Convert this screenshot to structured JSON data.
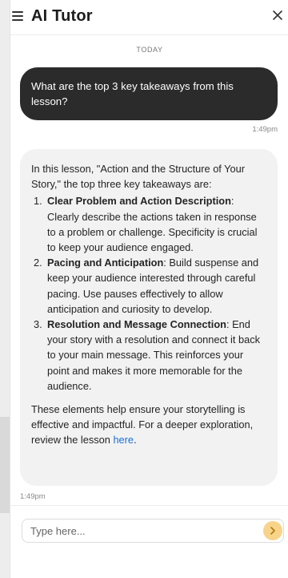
{
  "header": {
    "title": "AI Tutor"
  },
  "chat": {
    "date_separator": "TODAY",
    "user_message": "What are the top 3 key takeaways from this lesson?",
    "user_time": "1:49pm",
    "bot": {
      "intro": "In this lesson, \"Action and the Structure of Your Story,\" the top three key takeaways are:",
      "items": [
        {
          "num": "1.",
          "title": "Clear Problem and Action Description",
          "text": ": Clearly describe the actions taken in response to a problem or challenge. Specificity is crucial to keep your audience engaged."
        },
        {
          "num": "2.",
          "title": "Pacing and Anticipation",
          "text": ": Build suspense and keep your audience interested through careful pacing. Use pauses effectively to allow anticipation and curiosity to develop."
        },
        {
          "num": "3.",
          "title": "Resolution and Message Connection",
          "text": ": End your story with a resolution and connect it back to your main message. This reinforces your point and makes it more memorable for the audience."
        }
      ],
      "outro": "These elements help ensure your storytelling is effective and impactful. For a deeper exploration, review the lesson ",
      "link_text": "here",
      "outro_end": "."
    },
    "bot_time": "1:49pm"
  },
  "composer": {
    "placeholder": "Type here..."
  },
  "colors": {
    "user_bubble": "#2b2b2b",
    "bot_bubble": "#f2f2f2",
    "send_button": "#f7d48a",
    "link": "#1a6fd6"
  },
  "icons": {
    "menu": "hamburger-menu-icon",
    "close": "close-icon",
    "send": "chevron-right-icon"
  }
}
